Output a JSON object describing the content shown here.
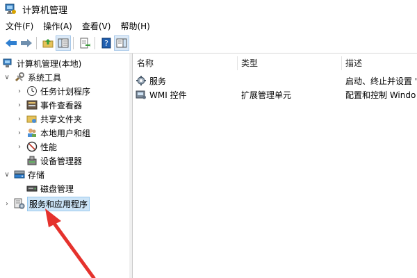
{
  "window": {
    "title": "计算机管理"
  },
  "menu": [
    "文件(F)",
    "操作(A)",
    "查看(V)",
    "帮助(H)"
  ],
  "toolbar": {
    "buttons": [
      "back-icon",
      "forward-icon",
      "up-folder-icon",
      "show-hide-tree-icon",
      "export-list-icon",
      "help-icon",
      "action-pane-icon"
    ]
  },
  "tree": {
    "root": "计算机管理(本地)",
    "system_tools": "系统工具",
    "task_scheduler": "任务计划程序",
    "event_viewer": "事件查看器",
    "shared_folders": "共享文件夹",
    "local_users": "本地用户和组",
    "performance": "性能",
    "device_manager": "设备管理器",
    "storage": "存储",
    "disk_management": "磁盘管理",
    "services_apps": "服务和应用程序"
  },
  "list": {
    "headers": [
      "名称",
      "类型",
      "描述"
    ],
    "rows": [
      {
        "name": "服务",
        "type": "",
        "desc": "启动、终止并设置 '"
      },
      {
        "name": "WMI 控件",
        "type": "扩展管理单元",
        "desc": "配置和控制 Windo"
      }
    ]
  },
  "colors": {
    "selection": "#cce4f7",
    "arrow": "#e5322d",
    "toolbar_blue": "#2f7fd0"
  }
}
